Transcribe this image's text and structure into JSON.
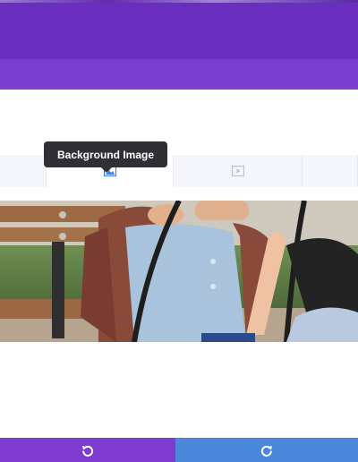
{
  "tooltip": {
    "text": "Background Image"
  },
  "tabs": [
    {
      "icon": "background-color-icon"
    },
    {
      "icon": "background-image-icon",
      "active": true
    },
    {
      "icon": "background-video-icon"
    },
    {
      "icon": "background-more-icon"
    }
  ],
  "preview": {
    "image": "children-on-swing-photo"
  },
  "footer": {
    "undo_icon": "undo-icon",
    "redo_icon": "redo-icon"
  },
  "colors": {
    "header": "#6a2fbf",
    "subheader": "#7b3fd0",
    "undo_button": "#7e3bd0",
    "redo_button": "#4a86d9",
    "tab_icon_active": "#3b7de0",
    "tab_icon_inactive": "#b9bfcb"
  }
}
